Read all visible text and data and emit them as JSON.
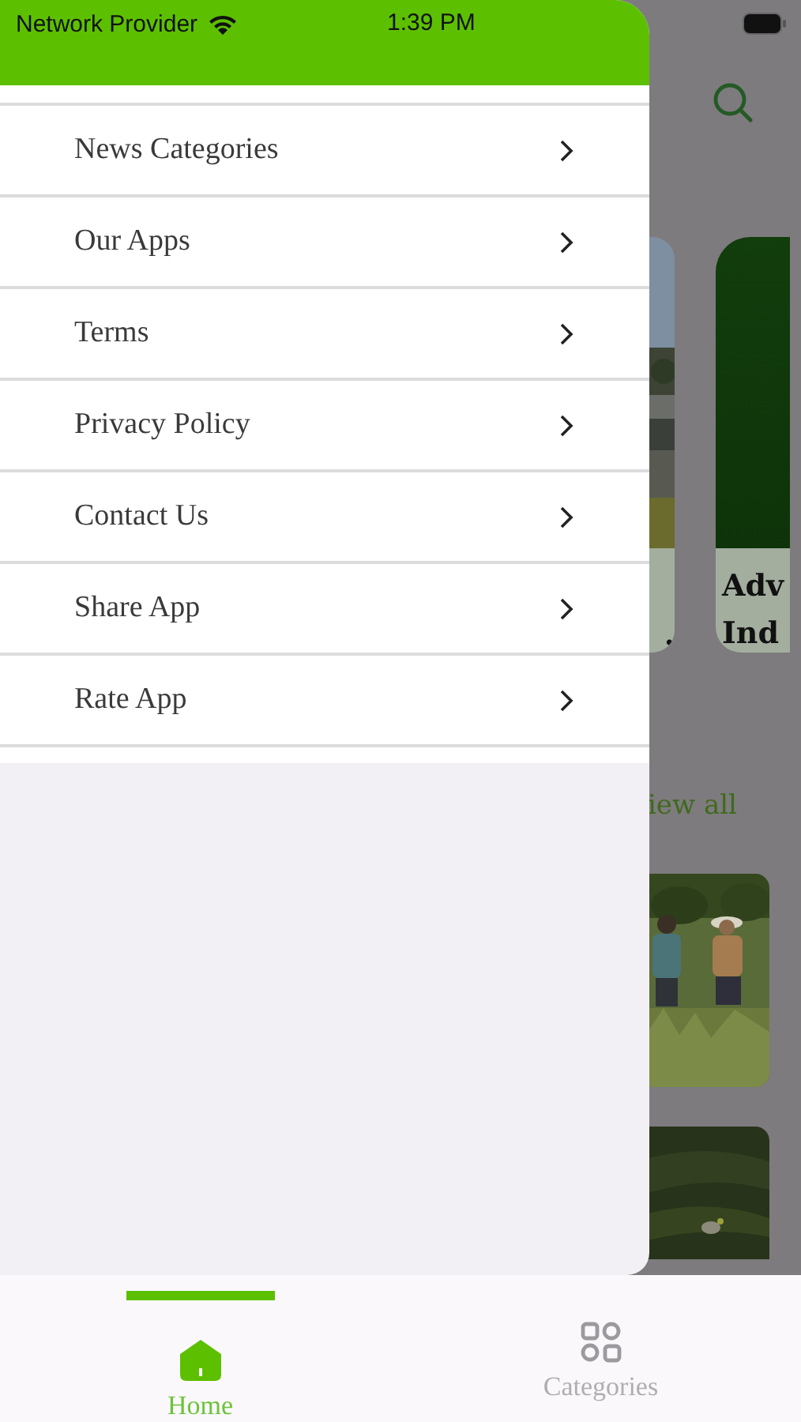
{
  "status_bar": {
    "carrier": "Network Provider",
    "time": "1:39 PM"
  },
  "drawer": {
    "items": [
      {
        "label": "News Categories"
      },
      {
        "label": "Our Apps"
      },
      {
        "label": "Terms"
      },
      {
        "label": "Privacy Policy"
      },
      {
        "label": "Contact Us"
      },
      {
        "label": "Share App"
      },
      {
        "label": "Rate App"
      }
    ]
  },
  "background": {
    "cards": [
      {
        "kind": "picture",
        "lines": [
          "."
        ]
      },
      {
        "kind": "solid",
        "lines": [
          "Adv",
          "Ind"
        ]
      }
    ],
    "view_all": "iew all"
  },
  "tab_bar": {
    "tabs": [
      {
        "label": "Home",
        "selected": true
      },
      {
        "label": "Categories",
        "selected": false
      }
    ]
  }
}
